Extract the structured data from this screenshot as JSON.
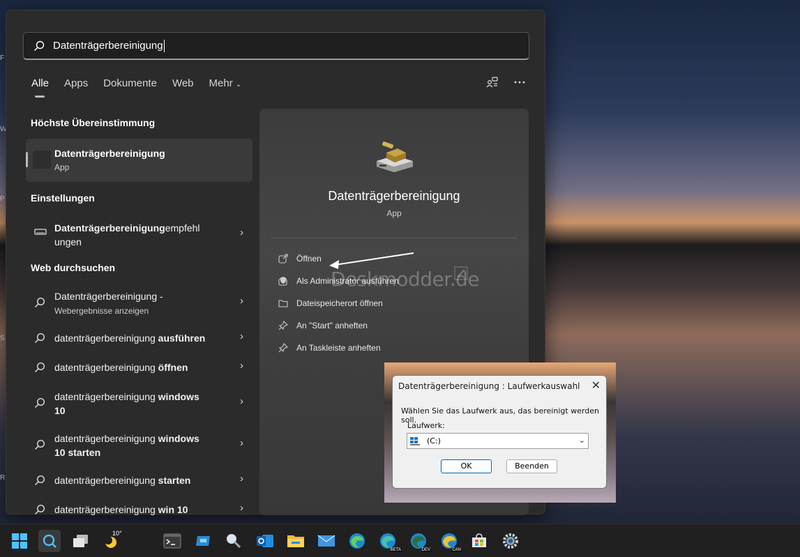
{
  "search": {
    "query": "Datenträgerbereinigung"
  },
  "tabs": [
    {
      "label": "Alle"
    },
    {
      "label": "Apps"
    },
    {
      "label": "Dokumente"
    },
    {
      "label": "Web"
    },
    {
      "label": "Mehr"
    }
  ],
  "sections": {
    "best": "Höchste Übereinstimmung",
    "settings": "Einstellungen",
    "web": "Web durchsuchen"
  },
  "best_match": {
    "title": "Datenträgerbereinigung",
    "type": "App"
  },
  "settings_item": {
    "bold": "Datenträgerbereinigung",
    "rest": "empfehl",
    "line2": "ungen"
  },
  "web_items": [
    {
      "plain": "Datenträgerbereinigung -",
      "sub": "Webergebnisse anzeigen"
    },
    {
      "plain": "datenträgerbereinigung ",
      "bold": "ausführen"
    },
    {
      "plain": "datenträgerbereinigung ",
      "bold": "öffnen"
    },
    {
      "plain": "datenträgerbereinigung ",
      "bold": "windows",
      "line2": "10"
    },
    {
      "plain": "datenträgerbereinigung ",
      "bold": "windows",
      "line2": "10 starten"
    },
    {
      "plain": "datenträgerbereinigung ",
      "bold": "starten"
    },
    {
      "plain": "datenträgerbereinigung ",
      "bold": "win 10"
    }
  ],
  "preview": {
    "name": "Datenträgerbereinigung",
    "type": "App",
    "actions": [
      {
        "label": "Öffnen",
        "icon": "open-external-icon"
      },
      {
        "label": "Als Administrator ausführen",
        "icon": "admin-shield-icon"
      },
      {
        "label": "Dateispeicherort öffnen",
        "icon": "folder-icon"
      },
      {
        "label": "An \"Start\" anheften",
        "icon": "pin-icon"
      },
      {
        "label": "An Taskleiste anheften",
        "icon": "pin-icon"
      }
    ],
    "watermark": "Deskmodder.de"
  },
  "dialog": {
    "title": "Datenträgerbereinigung : Laufwerkauswahl",
    "message": "Wählen Sie das Laufwerk aus, das bereinigt werden soll.",
    "drive_label": "Laufwerk:",
    "drive_value": "(C:)",
    "ok": "OK",
    "cancel": "Beenden"
  },
  "taskbar": {
    "weather_temp": "10°",
    "icons": [
      "windows-start-icon",
      "search-icon",
      "task-view-icon",
      "weather-icon",
      "terminal-icon",
      "remote-icon",
      "magnifier-icon",
      "outlook-icon",
      "file-explorer-icon",
      "mail-icon",
      "edge-icon",
      "edge-beta-icon",
      "edge-dev-icon",
      "edge-canary-icon",
      "store-icon",
      "settings-icon"
    ],
    "badges": {
      "beta": "BETA",
      "dev": "DEV",
      "canary": "CAN"
    }
  },
  "colors": {
    "panel": "#2b2b2b",
    "accent": "#0078d4",
    "taskbar": "#202020"
  }
}
